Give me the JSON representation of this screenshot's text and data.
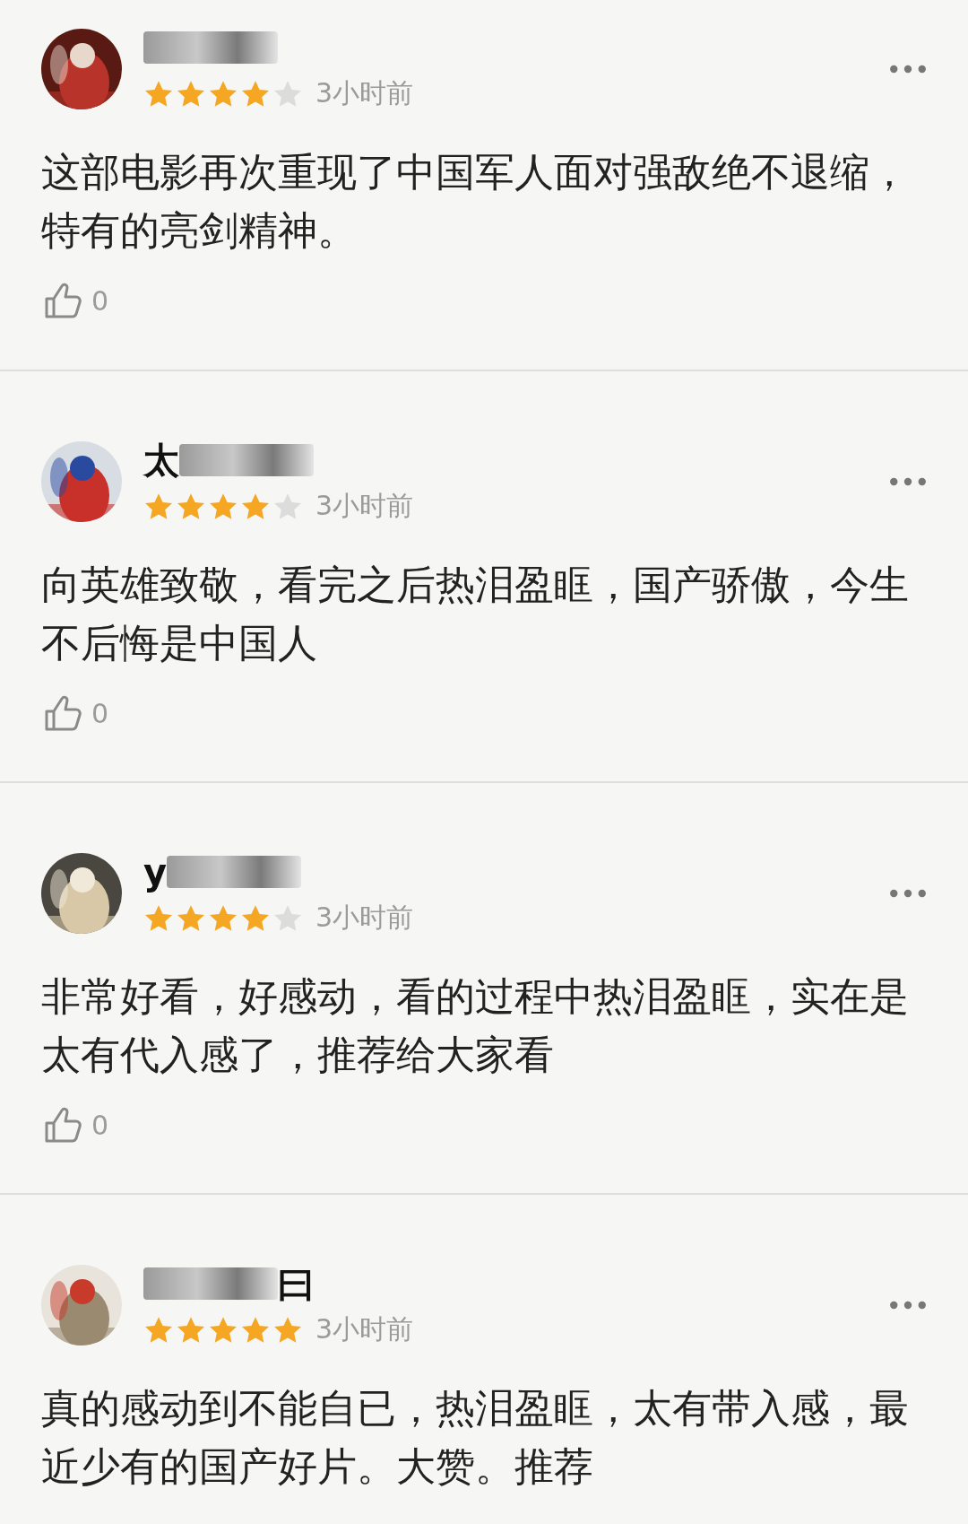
{
  "reviews": [
    {
      "blur_before": true,
      "blur_after": false,
      "stars": 4,
      "time": "3小时前",
      "text": "这部电影再次重现了中国军人面对强敌绝不退缩，特有的亮剑精神。",
      "likes": "0"
    },
    {
      "name": "太",
      "blur_before": false,
      "blur_after": true,
      "stars": 4,
      "time": "3小时前",
      "text": "向英雄致敬，看完之后热泪盈眶，国产骄傲，今生不后悔是中国人",
      "likes": "0"
    },
    {
      "name": "y",
      "blur_before": false,
      "blur_after": true,
      "stars": 4,
      "time": "3小时前",
      "text": "非常好看，好感动，看的过程中热泪盈眶，实在是太有代入感了，推荐给大家看",
      "likes": "0"
    },
    {
      "name": "曰",
      "blur_before": true,
      "blur_after": false,
      "stars": 5,
      "time": "3小时前",
      "text": "真的感动到不能自已，热泪盈眶，太有带入感，最近少有的国产好片。大赞。推荐"
    }
  ]
}
